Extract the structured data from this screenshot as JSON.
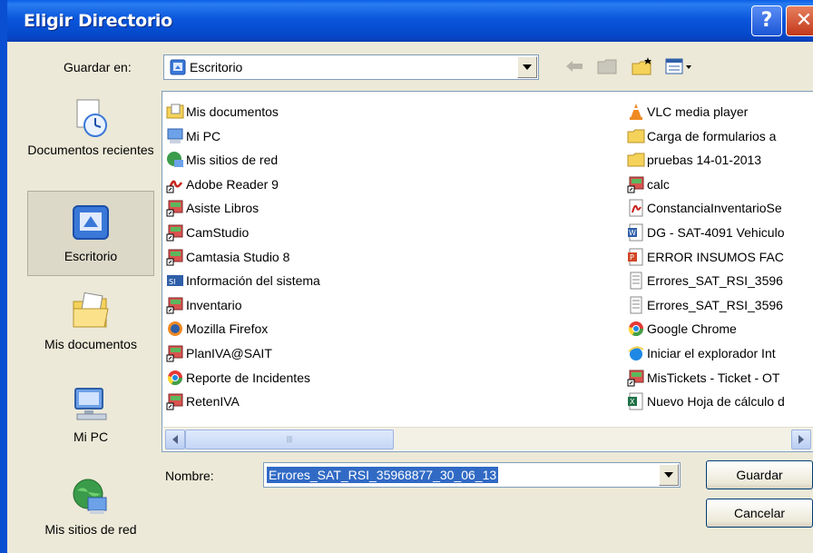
{
  "window": {
    "title": "Eligir Directorio",
    "help_glyph": "?",
    "close_glyph": "✕"
  },
  "look_in": {
    "label": "Guardar en:",
    "value": "Escritorio"
  },
  "places": [
    {
      "label": "Documentos recientes"
    },
    {
      "label": "Escritorio"
    },
    {
      "label": "Mis documentos"
    },
    {
      "label": "Mi PC"
    },
    {
      "label": "Mis sitios de red"
    }
  ],
  "files_left": [
    {
      "name": "Mis documentos",
      "icon": "folder-docs-icon"
    },
    {
      "name": "Mi PC",
      "icon": "computer-icon"
    },
    {
      "name": "Mis sitios de red",
      "icon": "network-icon"
    },
    {
      "name": "Adobe Reader 9",
      "icon": "pdf-shortcut-icon"
    },
    {
      "name": "Asiste Libros",
      "icon": "app-shortcut-icon"
    },
    {
      "name": "CamStudio",
      "icon": "app-shortcut-icon"
    },
    {
      "name": "Camtasia Studio 8",
      "icon": "app-shortcut-icon"
    },
    {
      "name": "Información del sistema",
      "icon": "sysinfo-icon"
    },
    {
      "name": "Inventario",
      "icon": "app-shortcut-icon"
    },
    {
      "name": "Mozilla Firefox",
      "icon": "firefox-icon"
    },
    {
      "name": "PlanIVA@SAIT",
      "icon": "app-shortcut-icon"
    },
    {
      "name": "Reporte de Incidentes",
      "icon": "chrome-icon"
    },
    {
      "name": "RetenIVA",
      "icon": "app-shortcut-icon"
    }
  ],
  "files_right": [
    {
      "name": "VLC media player",
      "icon": "vlc-icon"
    },
    {
      "name": "Carga de formularios a",
      "icon": "folder-icon"
    },
    {
      "name": "pruebas 14-01-2013",
      "icon": "folder-icon"
    },
    {
      "name": "calc",
      "icon": "app-shortcut-icon"
    },
    {
      "name": "ConstanciaInventarioSe",
      "icon": "pdf-icon"
    },
    {
      "name": "DG - SAT-4091 Vehiculo",
      "icon": "word-icon"
    },
    {
      "name": "ERROR INSUMOS FAC",
      "icon": "ppt-icon"
    },
    {
      "name": "Errores_SAT_RSI_3596",
      "icon": "text-file-icon"
    },
    {
      "name": "Errores_SAT_RSI_3596",
      "icon": "text-file-icon"
    },
    {
      "name": "Google Chrome",
      "icon": "chrome-icon"
    },
    {
      "name": "Iniciar el explorador Int",
      "icon": "ie-icon"
    },
    {
      "name": "MisTickets - Ticket - OT",
      "icon": "app-shortcut-icon"
    },
    {
      "name": "Nuevo Hoja de cálculo d",
      "icon": "excel-icon"
    }
  ],
  "scrollbar": {
    "thumb_glyph": "|||"
  },
  "file_name": {
    "label": "Nombre:",
    "value": "Errores_SAT_RSI_35968877_30_06_13"
  },
  "buttons": {
    "save": "Guardar",
    "cancel": "Cancelar"
  },
  "colors": {
    "titlebar": "#0a56dc",
    "dialog_bg": "#ece9d8",
    "selection": "#316ac5"
  }
}
